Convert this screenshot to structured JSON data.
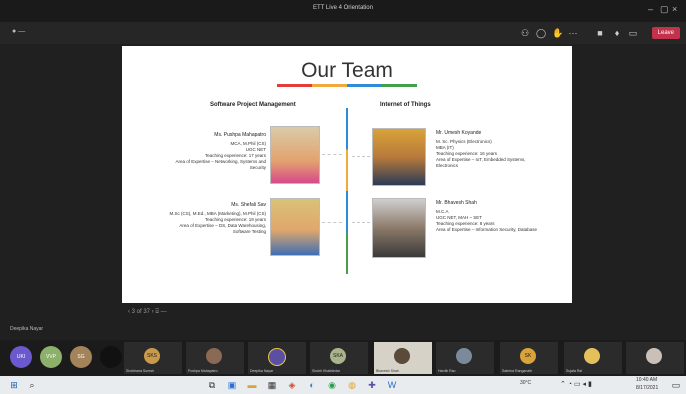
{
  "window": {
    "title": "ETT Live 4 Orientation"
  },
  "toolbar": {
    "left_label": "—",
    "leave_label": "Leave"
  },
  "slide": {
    "title": "Our Team",
    "left_heading": "Software Project Management",
    "right_heading": "Internet of Things",
    "people": [
      {
        "name": "Ms. Pushpa Mahapatro",
        "lines": [
          "MCA, M.Phil (CS)",
          "UGC NET",
          "Teaching experience: 17 years",
          "Area of Expertise – Networking, Systems and",
          "Security"
        ]
      },
      {
        "name": "Ms. Shefali Sav",
        "lines": [
          "M.Sc (CS), M.Ed., MBA (Marketing), M.Phil (CS)",
          "Teaching experience: 19 years",
          "Area of Expertise – DS, Data Warehousing,",
          "Software Testing"
        ]
      },
      {
        "name": "Mr. Umesh Koyande",
        "lines": [
          "M. Sc. Physics (Electronics)",
          "MBA (IT)",
          "Teaching experience: 16 years",
          "Area of Expertise – IoT, Embedded Systems,",
          "Electronics"
        ]
      },
      {
        "name": "Mr. Bhavesh Shah",
        "lines": [
          "M.C.A",
          "UGC NET, MAH – SET",
          "Teaching experience: 8 years",
          "Area of Expertise – Information Security, Database"
        ]
      }
    ],
    "nav": "‹  3 of 37  ›  ⌸  —"
  },
  "presenter": {
    "label": "Deepika Nayar"
  },
  "participants": [
    {
      "initials": "UKI",
      "color": "#6a5acd"
    },
    {
      "initials": "VVP",
      "color": "#8db06a"
    },
    {
      "initials": "SG",
      "color": "#a3845a"
    },
    {
      "initials": "",
      "color": "#111111"
    }
  ],
  "tiles": [
    {
      "initials": "SKS",
      "name": "Shobhana Suresh",
      "has_photo": false
    },
    {
      "initials": "",
      "name": "Pushpa Mahapatro",
      "has_photo": true
    },
    {
      "initials": "",
      "name": "Deepika Nayar",
      "has_photo": true
    },
    {
      "initials": "SKA",
      "name": "Shubh Khaitdedar",
      "has_photo": false
    },
    {
      "initials": "",
      "name": "Bhavesh Shah",
      "has_photo": true
    },
    {
      "initials": "",
      "name": "Hardik Rao",
      "has_photo": true
    },
    {
      "initials": "SK",
      "name": "Sabrina Ranganath",
      "has_photo": false
    },
    {
      "initials": "",
      "name": "Sujata Rai",
      "has_photo": true
    },
    {
      "initials": "",
      "name": "",
      "has_photo": true
    }
  ],
  "taskbar": {
    "weather": "30°C",
    "time": "10:40 AM",
    "date": "8/17/2021",
    "search_glyph": "⌕"
  },
  "colors": {
    "leave": "#c4314b",
    "accent_blue": "#2e8bd6",
    "accent_orange": "#f2a93b"
  }
}
